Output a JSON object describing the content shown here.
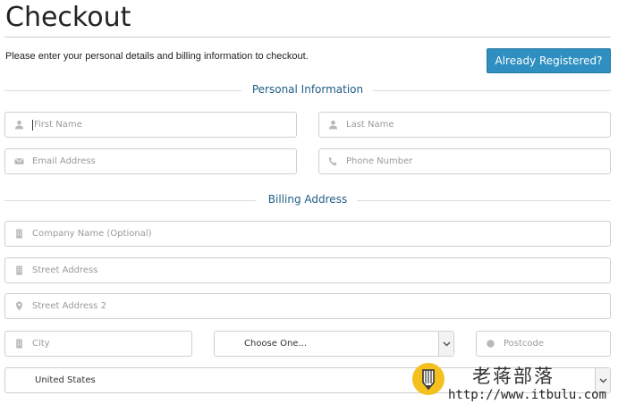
{
  "header": {
    "title": "Checkout",
    "intro": "Please enter your personal details and billing information to checkout.",
    "already_registered_label": "Already Registered?"
  },
  "personal": {
    "heading": "Personal Information",
    "first_name_placeholder": "First Name",
    "last_name_placeholder": "Last Name",
    "email_placeholder": "Email Address",
    "phone_placeholder": "Phone Number"
  },
  "billing": {
    "heading": "Billing Address",
    "company_placeholder": "Company Name (Optional)",
    "street_placeholder": "Street Address",
    "street2_placeholder": "Street Address 2",
    "city_placeholder": "City",
    "state_selected": "Choose One...",
    "postcode_placeholder": "Postcode",
    "country_selected": "United States"
  },
  "watermark": {
    "site_name": "老蒋部落",
    "url": "http://www.itbulu.com"
  },
  "icons": {
    "first_name": "user-icon",
    "last_name": "user-icon",
    "email": "envelope-icon",
    "phone": "phone-icon",
    "company": "building-icon",
    "street": "building-icon",
    "street2": "map-marker-icon",
    "city": "building-icon",
    "postcode": "circle-icon"
  },
  "colors": {
    "accent_button": "#2e8fc0",
    "section_heading": "#1e5d86",
    "watermark_logo": "#f4c01e"
  }
}
